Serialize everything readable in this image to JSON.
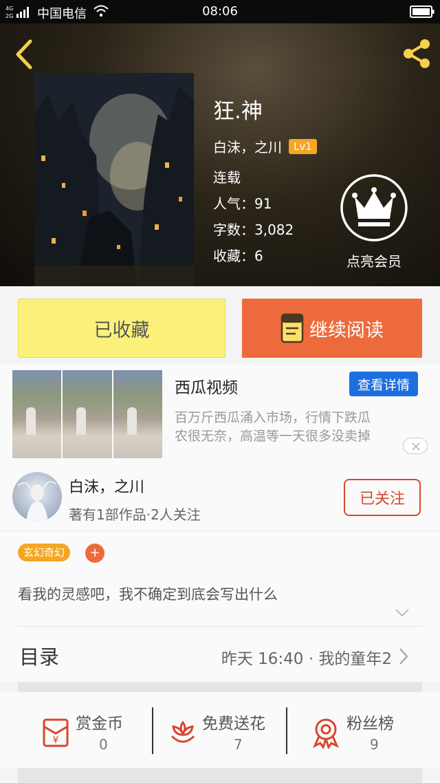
{
  "status_bar": {
    "network": "4G 2G",
    "carrier": "中国电信",
    "time": "08:06"
  },
  "book": {
    "title": "狂.神",
    "authors": "白沫，之川",
    "level": "Lv1",
    "status": "连载",
    "popularity": "人气：91",
    "word_count": "字数：3,082",
    "favorites": "收藏：6"
  },
  "vip": {
    "label": "点亮会员"
  },
  "actions": {
    "favorited_label": "已收藏",
    "continue_label": "继续阅读"
  },
  "ad": {
    "title": "西瓜视频",
    "detail_label": "查看详情",
    "description_line1": "百万斤西瓜涌入市场，行情下跌瓜",
    "description_line2": "农很无奈，高温等一天很多没卖掉"
  },
  "author": {
    "name": "白沫，之川",
    "subtitle": "著有1部作品·2人关注",
    "follow_label": "已关注"
  },
  "tags": {
    "items": [
      "玄幻奇幻"
    ],
    "add_label": "+"
  },
  "intro": "看我的灵感吧，我不确定到底会写出什么",
  "catalog": {
    "label": "目录",
    "latest": "昨天 16:40 · 我的童年2"
  },
  "stats": [
    {
      "label": "赏金币",
      "value": "0",
      "icon": "red-envelope-icon"
    },
    {
      "label": "免费送花",
      "value": "7",
      "icon": "flower-icon"
    },
    {
      "label": "粉丝榜",
      "value": "9",
      "icon": "medal-icon"
    }
  ],
  "colors": {
    "accent_orange": "#ec6a3b",
    "fav_yellow": "#fbf17a",
    "follow_red": "#d9452f",
    "ad_blue": "#1d6fe0",
    "tag_orange": "#f5a623"
  }
}
